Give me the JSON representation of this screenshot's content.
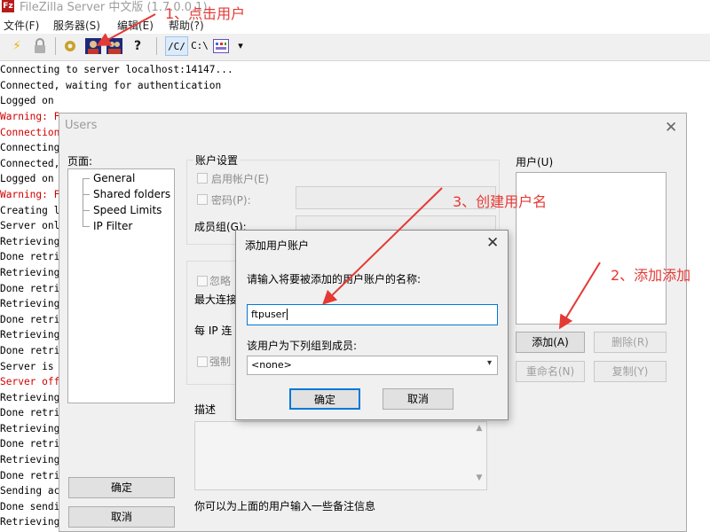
{
  "window": {
    "title": "FileZilla Server 中文版 (1.7.0.0.1)"
  },
  "menu": [
    "文件(F)",
    "服务器(S)",
    "编辑(E)",
    "帮助(?)"
  ],
  "toolbar": {
    "c_root": "/C/",
    "c_dir": "C:\\",
    "dropdown": "▾"
  },
  "log": [
    {
      "text": "Connecting to server localhost:14147...",
      "err": false
    },
    {
      "text": "Connected, waiting for authentication",
      "err": false
    },
    {
      "text": "Logged on",
      "err": false
    },
    {
      "text": "Warning: F",
      "err": true
    },
    {
      "text": "Connection",
      "err": true
    },
    {
      "text": "Connecting",
      "err": false
    },
    {
      "text": "Connected,",
      "err": false
    },
    {
      "text": "Logged on",
      "err": false
    },
    {
      "text": "Warning: F",
      "err": true
    },
    {
      "text": "Creating l",
      "err": false
    },
    {
      "text": "Server onl",
      "err": false
    },
    {
      "text": "Retrieving",
      "err": false
    },
    {
      "text": "Done retri",
      "err": false
    },
    {
      "text": "Retrieving",
      "err": false
    },
    {
      "text": "Done retri",
      "err": false
    },
    {
      "text": "Retrieving",
      "err": false
    },
    {
      "text": "Done retri",
      "err": false
    },
    {
      "text": "Retrieving",
      "err": false
    },
    {
      "text": "Done retri",
      "err": false
    },
    {
      "text": "Server is",
      "err": false
    },
    {
      "text": "Server off",
      "err": true
    },
    {
      "text": "Retrieving",
      "err": false
    },
    {
      "text": "Done retri",
      "err": false
    },
    {
      "text": "Retrieving",
      "err": false
    },
    {
      "text": "Done retri",
      "err": false
    },
    {
      "text": "Retrieving",
      "err": false
    },
    {
      "text": "Done retri",
      "err": false
    },
    {
      "text": "Sending ac",
      "err": false
    },
    {
      "text": "Done sendi",
      "err": false
    },
    {
      "text": "Retrieving",
      "err": false
    }
  ],
  "users_dialog": {
    "title": "Users",
    "pages_label": "页面:",
    "pages": [
      "General",
      "Shared folders",
      "Speed Limits",
      "IP Filter"
    ],
    "ok": "确定",
    "cancel": "取消",
    "account_settings": "账户设置",
    "enable_account": "启用帐户(E)",
    "password": "密码(P):",
    "group_member": "成员组(G):",
    "ignore": "忽略",
    "max_conn": "最大连接",
    "per_ip": "每 IP 连",
    "force": "强制",
    "description": "描述",
    "desc_hint": "你可以为上面的用户输入一些备注信息",
    "users_label": "用户(U)",
    "add": "添加(A)",
    "remove": "删除(R)",
    "rename": "重命名(N)",
    "copy": "复制(Y)"
  },
  "add_dialog": {
    "title": "添加用户账户",
    "prompt": "请输入将要被添加的用户账户的名称:",
    "username": "ftpuser",
    "group_prompt": "该用户为下列组到成员:",
    "group_value": "<none>",
    "ok": "确定",
    "cancel": "取消"
  },
  "annotations": {
    "step1": "1、点击用户",
    "step2": "2、添加添加",
    "step3": "3、创建用户名",
    "color": "#e53935"
  }
}
